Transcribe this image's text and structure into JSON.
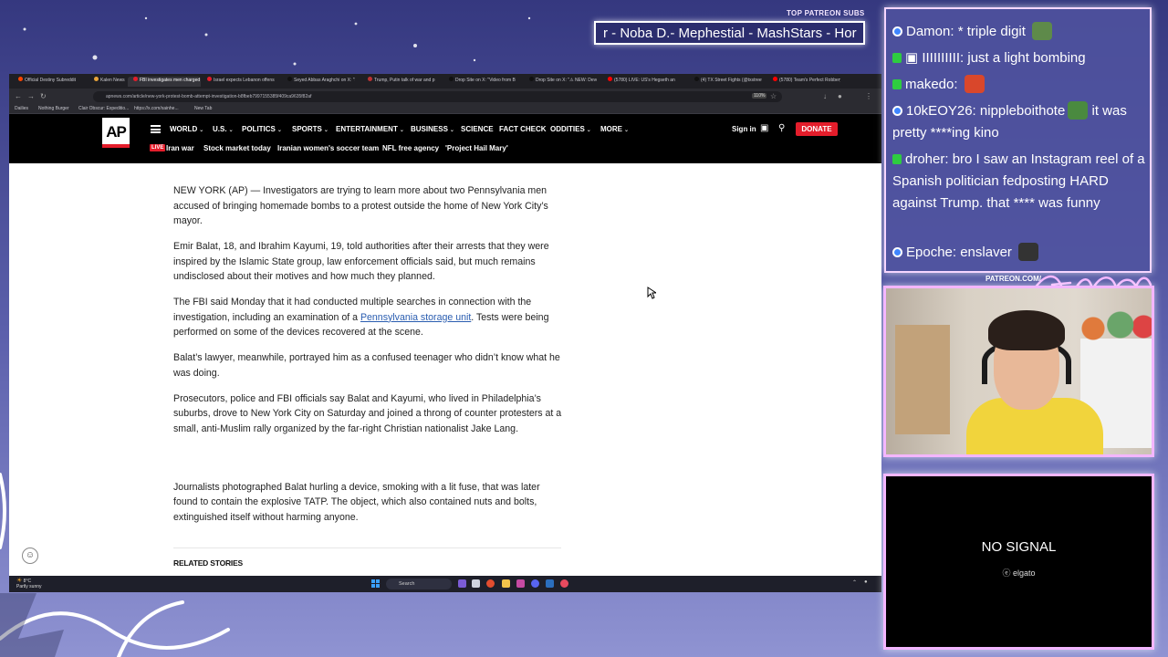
{
  "overlay": {
    "top_patreon_label": "TOP PATREON SUBS",
    "ticker_text": "r - Noba D.- Mephestial - MashStars - Hor",
    "patreon_url": "PATREON.COM/"
  },
  "browser": {
    "tabs": [
      {
        "title": "Official Destiny Subreddit",
        "fav": "#ff4500"
      },
      {
        "title": "Kalen News",
        "fav": "#e8a33a"
      },
      {
        "title": "FBI investigates men charged i",
        "fav": "#e41d2b",
        "active": true
      },
      {
        "title": "Israel expects Lebanon offensi",
        "fav": "#e41d2b"
      },
      {
        "title": "Seyed Abbas Araghchi on X: \"I",
        "fav": "#111111"
      },
      {
        "title": "Trump, Putin talk of war and p",
        "fav": "#bb3333"
      },
      {
        "title": "Drop Site on X: \"Video from B",
        "fav": "#111111"
      },
      {
        "title": "Drop Site on X: \"⚠ NEW: Devo",
        "fav": "#111111"
      },
      {
        "title": "(5780) LIVE: US's Hegseth and",
        "fav": "#ff0000"
      },
      {
        "title": "(4) TX Street Fights (@txstreet",
        "fav": "#111111"
      },
      {
        "title": "(5780) Team's Perfect Robbery",
        "fav": "#ff0000"
      }
    ],
    "url": "apnews.com/article/new-york-protest-bomb-attempt-investigation-b8fbeb7997155385f409ca9635f82af",
    "zoom": "110%",
    "bookmarks": [
      "Dailies",
      "Nothing Burger",
      "Clair Obscur: Expeditio...",
      "https://x.com/xainhe...",
      "New Tab"
    ]
  },
  "ap": {
    "logo": "AP",
    "nav": [
      {
        "label": "WORLD",
        "chev": true
      },
      {
        "label": "U.S.",
        "chev": true
      },
      {
        "label": "POLITICS",
        "chev": true
      },
      {
        "label": "SPORTS",
        "chev": true
      },
      {
        "label": "ENTERTAINMENT",
        "chev": true
      },
      {
        "label": "BUSINESS",
        "chev": true
      },
      {
        "label": "SCIENCE",
        "chev": false
      },
      {
        "label": "FACT CHECK",
        "chev": false
      },
      {
        "label": "ODDITIES",
        "chev": true
      },
      {
        "label": "MORE",
        "chev": true
      }
    ],
    "sign_in": "Sign in",
    "donate": "DONATE",
    "live_badge": "LIVE",
    "trending": [
      "Iran war",
      "Stock market today",
      "Iranian women's soccer team",
      "NFL free agency",
      "'Project Hail Mary'"
    ]
  },
  "article": {
    "paragraphs": [
      {
        "text": "NEW YORK (AP) — Investigators are trying to learn more about two Pennsylvania men accused of bringing homemade bombs to a protest outside the home of New York City’s mayor."
      },
      {
        "text": "Emir Balat, 18, and Ibrahim Kayumi, 19, told authorities after their arrests that they were inspired by the Islamic State group, law enforcement officials said, but much remains undisclosed about their motives and how much they planned."
      },
      {
        "before": "The FBI said Monday that it had conducted multiple searches in connection with the investigation, including an examination of a ",
        "link": "Pennsylvania storage unit",
        "after": ". Tests were being performed on some of the devices recovered at the scene."
      },
      {
        "text": "Balat’s lawyer, meanwhile, portrayed him as a confused teenager who didn’t know what he was doing."
      },
      {
        "text": "Prosecutors, police and FBI officials say Balat and Kayumi, who lived in Philadelphia’s suburbs, drove to New York City on Saturday and joined a throng of counter protesters at a small, anti-Muslim rally organized by the far-right Christian nationalist Jake Lang."
      },
      {
        "text": "Journalists photographed Balat hurling a device, smoking with a lit fuse, that was later found to contain the explosive TATP. The object, which also contained nuts and bolts, extinguished itself without harming anyone."
      }
    ],
    "related_label": "RELATED STORIES"
  },
  "taskbar": {
    "weather_temp": "8°C",
    "weather_desc": "Partly sunny",
    "search_label": "Search"
  },
  "chat": {
    "messages": [
      {
        "badge": "sub",
        "user": "Damon:",
        "text": "* triple digit",
        "emote": "#5e8a4a"
      },
      {
        "badge": "kick",
        "user": "▣ IIIIIIIIII:",
        "text": "just a light bombing"
      },
      {
        "badge": "kick",
        "user": "makedo:",
        "text": "",
        "emote": "#d9472b"
      },
      {
        "badge": "sub",
        "user": "10kEOY26:",
        "text": "nippleboithote",
        "emote": "#4a8a3f",
        "text2": "it was pretty ****ing kino"
      },
      {
        "badge": "kick",
        "user": "droher:",
        "text": "bro I saw an Instagram reel of a Spanish politician fedposting HARD against Trump. that **** was funny"
      },
      {
        "badge": "sub",
        "user": "Epoche:",
        "text": "enslaver",
        "emote": "#333333"
      }
    ]
  },
  "nosignal": {
    "text": "NO SIGNAL",
    "brand": "ⓔ elgato"
  }
}
